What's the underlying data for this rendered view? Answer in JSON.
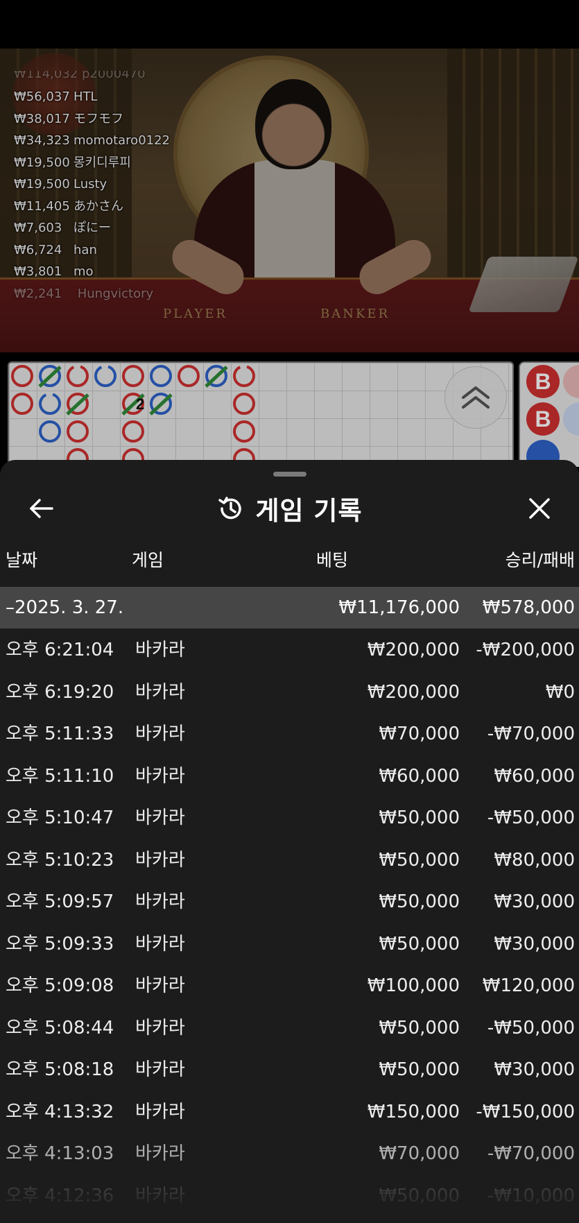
{
  "leaderboard": {
    "top_partial": "₩114,032  p2000470",
    "rows": [
      {
        "amount": "₩56,037",
        "name": "HTL"
      },
      {
        "amount": "₩38,017",
        "name": "モフモフ"
      },
      {
        "amount": "₩34,323",
        "name": "momotaro0122"
      },
      {
        "amount": "₩19,500",
        "name": "몽키디루피"
      },
      {
        "amount": "₩19,500",
        "name": "Lusty"
      },
      {
        "amount": "₩11,405",
        "name": "あかさん"
      },
      {
        "amount": "₩7,603",
        "name": "ぽにー"
      },
      {
        "amount": "₩6,724",
        "name": "han"
      },
      {
        "amount": "₩3,801",
        "name": "mo"
      }
    ],
    "bottom_partial": {
      "amount": "₩2,241",
      "name": "Hungvictory"
    }
  },
  "video": {
    "player_label": "PLAYER",
    "banker_label": "BANKER"
  },
  "roadmap": {
    "tie_count": "2",
    "bead_label": "B"
  },
  "sheet": {
    "title": "게임 기록",
    "icons": {
      "back": "arrow-left-icon",
      "history": "history-icon",
      "close": "close-icon",
      "collapse": "chevron-double-up-icon"
    }
  },
  "columns": {
    "date": "날짜",
    "game": "게임",
    "bet": "베팅",
    "result": "승리/패배"
  },
  "date_group": {
    "date": "–2025. 3. 27.",
    "total_bet": "₩11,176,000",
    "total_result": "₩578,000"
  },
  "records": [
    {
      "time": "오후 6:21:04",
      "game": "바카라",
      "bet": "₩200,000",
      "result": "-₩200,000"
    },
    {
      "time": "오후 6:19:20",
      "game": "바카라",
      "bet": "₩200,000",
      "result": "₩0"
    },
    {
      "time": "오후 5:11:33",
      "game": "바카라",
      "bet": "₩70,000",
      "result": "-₩70,000"
    },
    {
      "time": "오후 5:11:10",
      "game": "바카라",
      "bet": "₩60,000",
      "result": "₩60,000"
    },
    {
      "time": "오후 5:10:47",
      "game": "바카라",
      "bet": "₩50,000",
      "result": "-₩50,000"
    },
    {
      "time": "오후 5:10:23",
      "game": "바카라",
      "bet": "₩50,000",
      "result": "₩80,000"
    },
    {
      "time": "오후 5:09:57",
      "game": "바카라",
      "bet": "₩50,000",
      "result": "₩30,000"
    },
    {
      "time": "오후 5:09:33",
      "game": "바카라",
      "bet": "₩50,000",
      "result": "₩30,000"
    },
    {
      "time": "오후 5:09:08",
      "game": "바카라",
      "bet": "₩100,000",
      "result": "₩120,000"
    },
    {
      "time": "오후 5:08:44",
      "game": "바카라",
      "bet": "₩50,000",
      "result": "-₩50,000"
    },
    {
      "time": "오후 5:08:18",
      "game": "바카라",
      "bet": "₩50,000",
      "result": "₩30,000"
    },
    {
      "time": "오후 4:13:32",
      "game": "바카라",
      "bet": "₩150,000",
      "result": "-₩150,000"
    },
    {
      "time": "오후 4:13:03",
      "game": "바카라",
      "bet": "₩70,000",
      "result": "-₩70,000"
    },
    {
      "time": "오후 4:12:36",
      "game": "바카라",
      "bet": "₩50,000",
      "result": "-₩10,000"
    }
  ],
  "colors": {
    "sheet_bg": "#1c1c1c",
    "date_row_bg": "#464646",
    "banker_red": "#d03030",
    "player_blue": "#2e62c8",
    "tie_green": "#2f8a3a"
  }
}
